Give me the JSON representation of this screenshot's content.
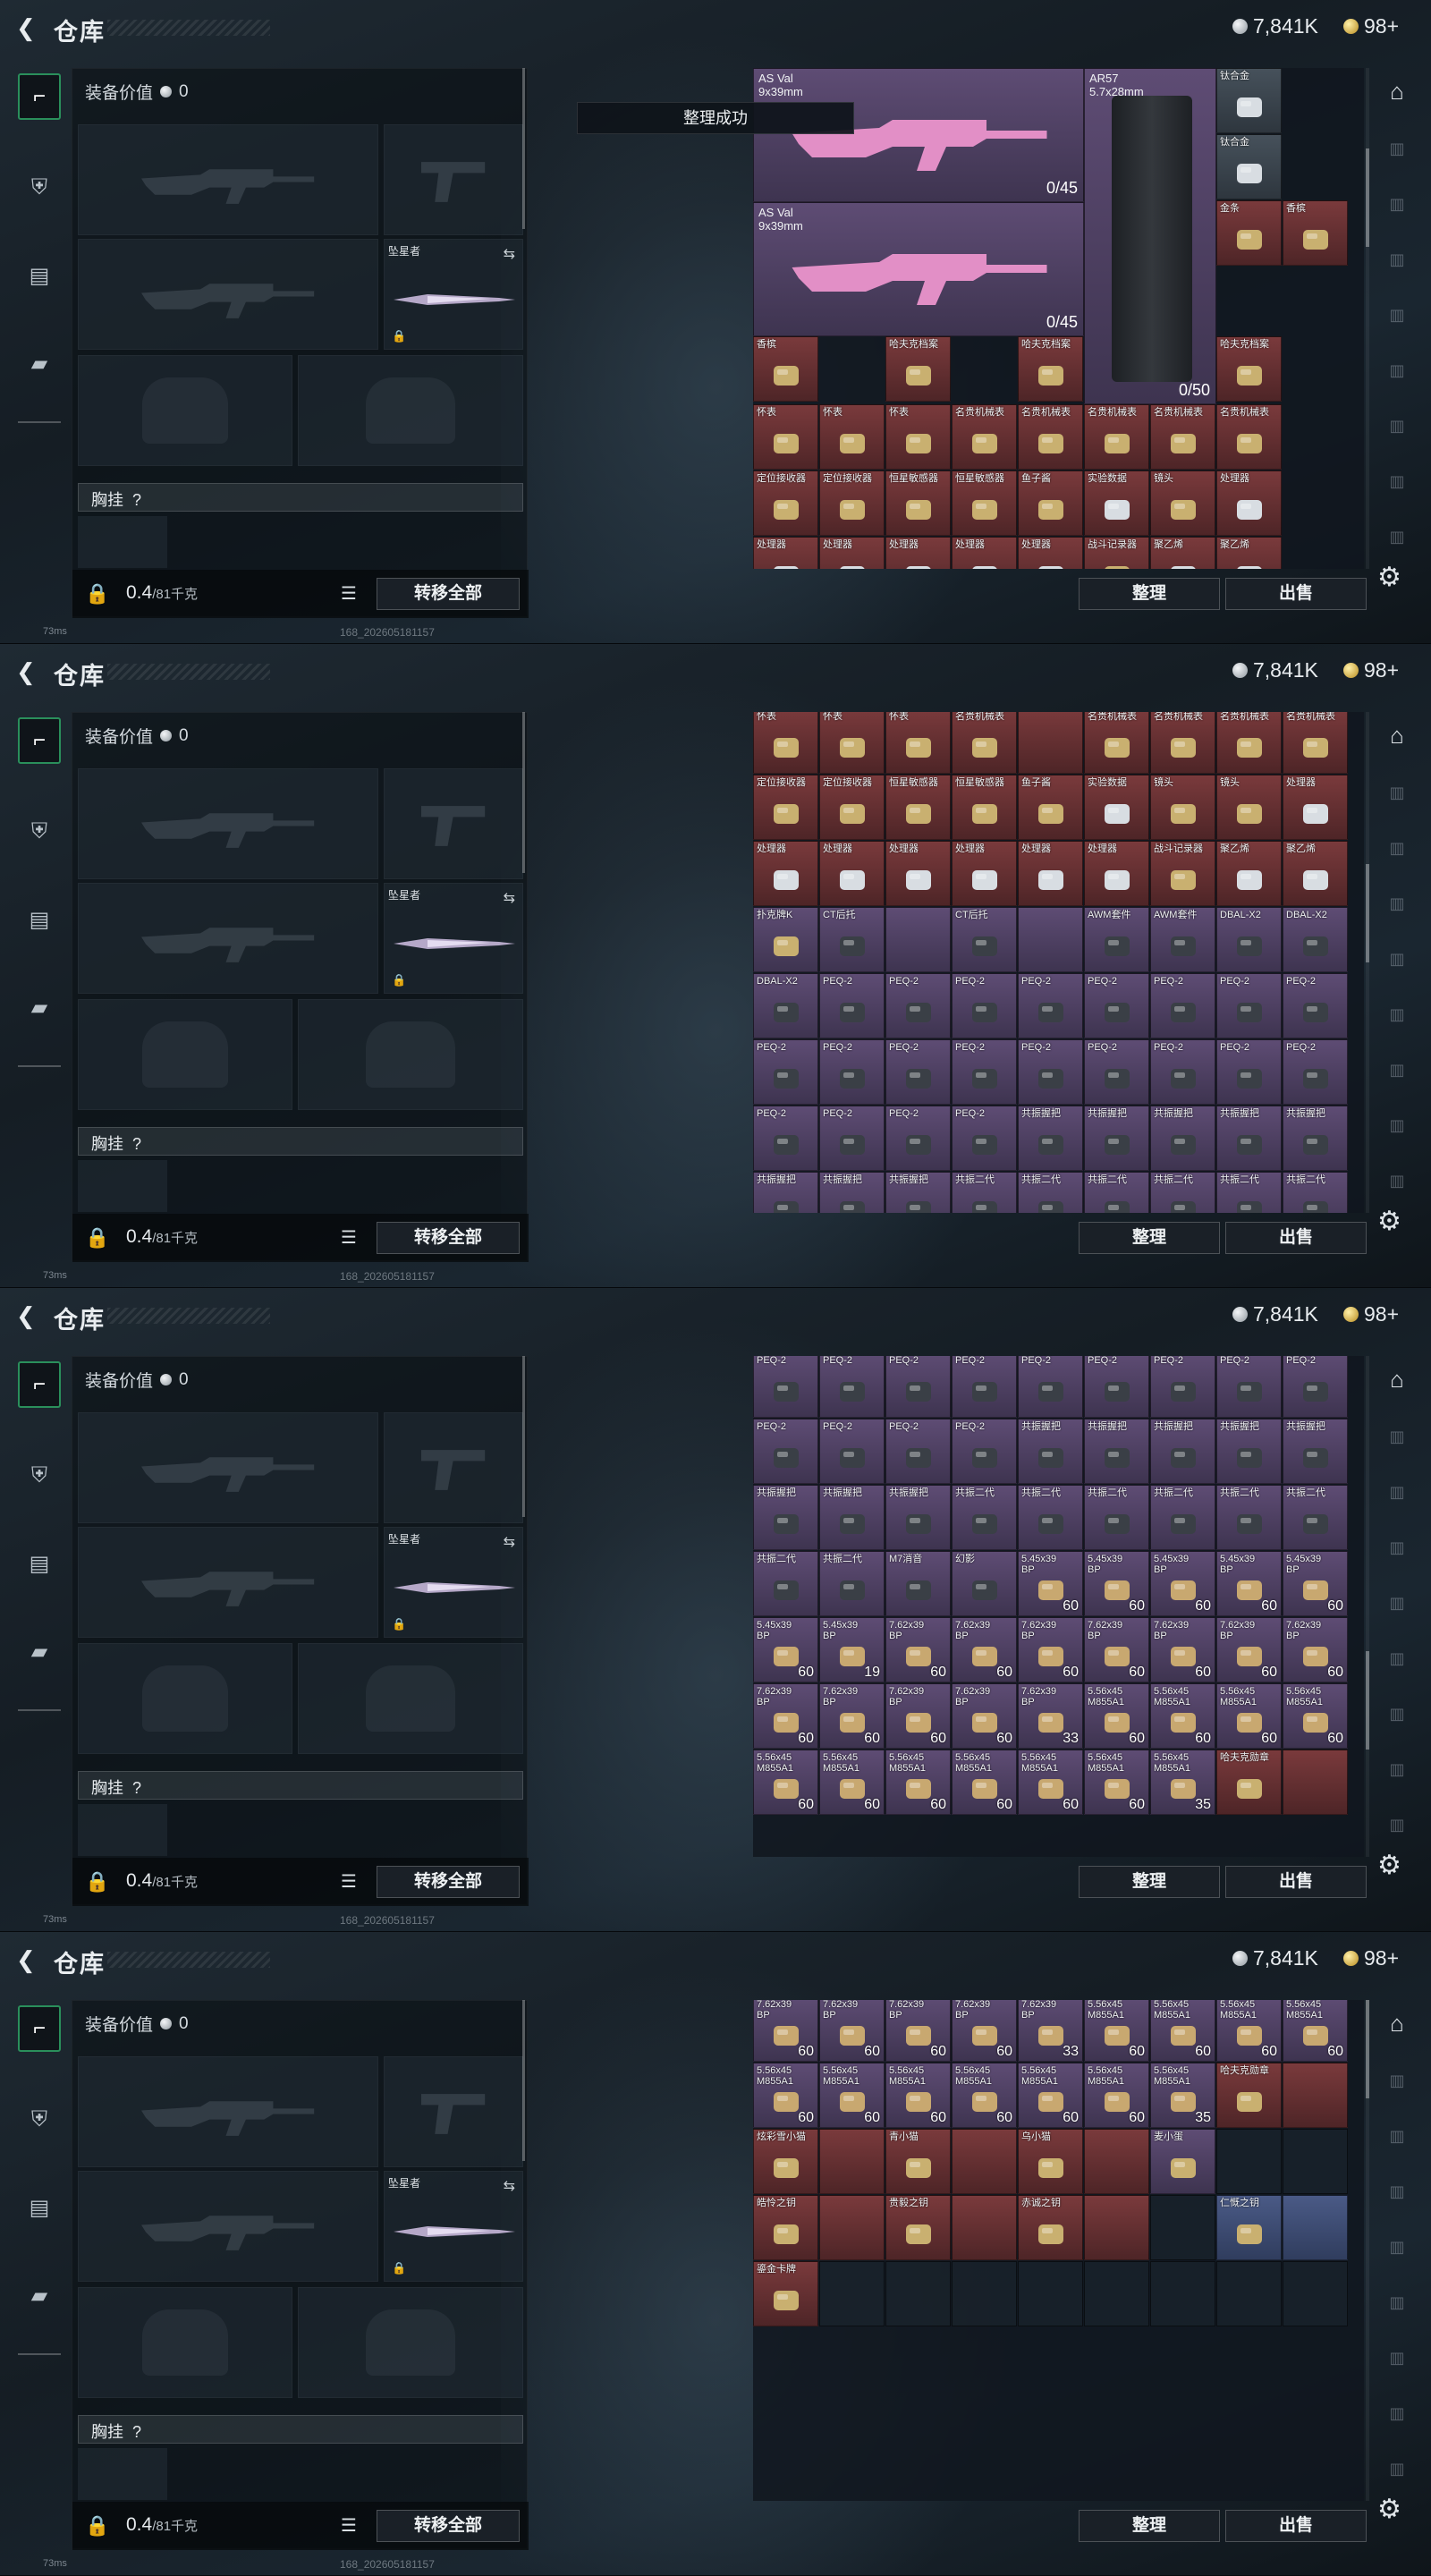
{
  "header": {
    "title": "仓库",
    "silver": "7,841K",
    "gold": "98+"
  },
  "loadout": {
    "value_label": "装备价值",
    "value": "0",
    "melee_name": "坠星者",
    "chest_label": "胸挂",
    "chest_hint": "?",
    "weight_current": "0.4",
    "weight_max": "/81千克",
    "transfer_all": "转移全部"
  },
  "footer": {
    "sort": "整理",
    "sell": "出售",
    "ping": "73ms",
    "build": "168_202605181157"
  },
  "toast": "整理成功",
  "frame1": {
    "weapons": [
      {
        "name": "AS Val\n9x39mm",
        "ammo": "0/45"
      },
      {
        "name": "AS Val\n9x39mm",
        "ammo": "0/45"
      },
      {
        "name": "AR57\n5.7x28mm",
        "ammo": "0/50"
      }
    ],
    "cells": [
      {
        "n": "钛合金",
        "r": "gray"
      },
      {
        "n": "钛合金",
        "r": "gray"
      },
      {
        "n": "金条",
        "r": "red"
      },
      {
        "n": "香槟",
        "r": "red"
      },
      {
        "n": "香槟",
        "r": "red"
      },
      {
        "n": "哈夫克档案",
        "r": "red"
      },
      {
        "n": "哈夫克档案",
        "r": "red"
      },
      {
        "n": "哈夫克档案",
        "r": "red"
      },
      {
        "n": "怀表",
        "r": "red"
      },
      {
        "n": "怀表",
        "r": "red"
      },
      {
        "n": "怀表",
        "r": "red"
      },
      {
        "n": "名贵机械表",
        "r": "red"
      },
      {
        "n": "名贵机械表",
        "r": "red"
      },
      {
        "n": "名贵机械表",
        "r": "red"
      },
      {
        "n": "名贵机械表",
        "r": "red"
      },
      {
        "n": "名贵机械表",
        "r": "red"
      },
      {
        "n": "定位接收器",
        "r": "red"
      },
      {
        "n": "定位接收器",
        "r": "red"
      },
      {
        "n": "恒星敏感器",
        "r": "red"
      },
      {
        "n": "恒星敏感器",
        "r": "red"
      },
      {
        "n": "鱼子酱",
        "r": "red"
      },
      {
        "n": "实验数据",
        "r": "red"
      },
      {
        "n": "镜头",
        "r": "red"
      },
      {
        "n": "处理器",
        "r": "red"
      },
      {
        "n": "处理器",
        "r": "red"
      },
      {
        "n": "处理器",
        "r": "red"
      },
      {
        "n": "处理器",
        "r": "red"
      },
      {
        "n": "处理器",
        "r": "red"
      },
      {
        "n": "处理器",
        "r": "red"
      },
      {
        "n": "战斗记录器",
        "r": "red"
      },
      {
        "n": "聚乙烯",
        "r": "red"
      },
      {
        "n": "聚乙烯",
        "r": "red"
      }
    ]
  },
  "frame2": {
    "rows": [
      [
        {
          "n": "怀表",
          "r": "red"
        },
        {
          "n": "怀表",
          "r": "red"
        },
        {
          "n": "怀表",
          "r": "red"
        },
        {
          "n": "名贵机械表",
          "r": "red"
        },
        {
          "n": "",
          "r": "red"
        },
        {
          "n": "名贵机械表",
          "r": "red"
        },
        {
          "n": "名贵机械表",
          "r": "red"
        },
        {
          "n": "名贵机械表",
          "r": "red"
        },
        {
          "n": "名贵机械表",
          "r": "red"
        }
      ],
      [
        {
          "n": "定位接收器",
          "r": "red"
        },
        {
          "n": "定位接收器",
          "r": "red"
        },
        {
          "n": "恒星敏感器",
          "r": "red"
        },
        {
          "n": "恒星敏感器",
          "r": "red"
        },
        {
          "n": "鱼子酱",
          "r": "red"
        },
        {
          "n": "实验数据",
          "r": "red"
        },
        {
          "n": "镜头",
          "r": "red"
        },
        {
          "n": "镜头",
          "r": "red"
        },
        {
          "n": "处理器",
          "r": "red"
        }
      ],
      [
        {
          "n": "处理器",
          "r": "red"
        },
        {
          "n": "处理器",
          "r": "red"
        },
        {
          "n": "处理器",
          "r": "red"
        },
        {
          "n": "处理器",
          "r": "red"
        },
        {
          "n": "处理器",
          "r": "red"
        },
        {
          "n": "处理器",
          "r": "red"
        },
        {
          "n": "战斗记录器",
          "r": "red"
        },
        {
          "n": "聚乙烯",
          "r": "red"
        },
        {
          "n": "聚乙烯",
          "r": "red"
        }
      ],
      [
        {
          "n": "扑克牌K",
          "r": "purple"
        },
        {
          "n": "CT后托",
          "r": "purple"
        },
        {
          "n": "",
          "r": "purple"
        },
        {
          "n": "CT后托",
          "r": "purple"
        },
        {
          "n": "",
          "r": "purple"
        },
        {
          "n": "AWM套件",
          "r": "purple"
        },
        {
          "n": "AWM套件",
          "r": "purple"
        },
        {
          "n": "DBAL-X2",
          "r": "purple"
        },
        {
          "n": "DBAL-X2",
          "r": "purple"
        }
      ],
      [
        {
          "n": "DBAL-X2",
          "r": "purple"
        },
        {
          "n": "PEQ-2",
          "r": "purple"
        },
        {
          "n": "PEQ-2",
          "r": "purple"
        },
        {
          "n": "PEQ-2",
          "r": "purple"
        },
        {
          "n": "PEQ-2",
          "r": "purple"
        },
        {
          "n": "PEQ-2",
          "r": "purple"
        },
        {
          "n": "PEQ-2",
          "r": "purple"
        },
        {
          "n": "PEQ-2",
          "r": "purple"
        },
        {
          "n": "PEQ-2",
          "r": "purple"
        }
      ],
      [
        {
          "n": "PEQ-2",
          "r": "purple"
        },
        {
          "n": "PEQ-2",
          "r": "purple"
        },
        {
          "n": "PEQ-2",
          "r": "purple"
        },
        {
          "n": "PEQ-2",
          "r": "purple"
        },
        {
          "n": "PEQ-2",
          "r": "purple"
        },
        {
          "n": "PEQ-2",
          "r": "purple"
        },
        {
          "n": "PEQ-2",
          "r": "purple"
        },
        {
          "n": "PEQ-2",
          "r": "purple"
        },
        {
          "n": "PEQ-2",
          "r": "purple"
        }
      ],
      [
        {
          "n": "PEQ-2",
          "r": "purple"
        },
        {
          "n": "PEQ-2",
          "r": "purple"
        },
        {
          "n": "PEQ-2",
          "r": "purple"
        },
        {
          "n": "PEQ-2",
          "r": "purple"
        },
        {
          "n": "共振握把",
          "r": "purple"
        },
        {
          "n": "共振握把",
          "r": "purple"
        },
        {
          "n": "共振握把",
          "r": "purple"
        },
        {
          "n": "共振握把",
          "r": "purple"
        },
        {
          "n": "共振握把",
          "r": "purple"
        }
      ],
      [
        {
          "n": "共振握把",
          "r": "purple"
        },
        {
          "n": "共振握把",
          "r": "purple"
        },
        {
          "n": "共振握把",
          "r": "purple"
        },
        {
          "n": "共振二代",
          "r": "purple"
        },
        {
          "n": "共振二代",
          "r": "purple"
        },
        {
          "n": "共振二代",
          "r": "purple"
        },
        {
          "n": "共振二代",
          "r": "purple"
        },
        {
          "n": "共振二代",
          "r": "purple"
        },
        {
          "n": "共振二代",
          "r": "purple"
        }
      ]
    ]
  },
  "frame3": {
    "rows": [
      [
        {
          "n": "PEQ-2",
          "r": "purple"
        },
        {
          "n": "PEQ-2",
          "r": "purple"
        },
        {
          "n": "PEQ-2",
          "r": "purple"
        },
        {
          "n": "PEQ-2",
          "r": "purple"
        },
        {
          "n": "PEQ-2",
          "r": "purple"
        },
        {
          "n": "PEQ-2",
          "r": "purple"
        },
        {
          "n": "PEQ-2",
          "r": "purple"
        },
        {
          "n": "PEQ-2",
          "r": "purple"
        },
        {
          "n": "PEQ-2",
          "r": "purple"
        }
      ],
      [
        {
          "n": "PEQ-2",
          "r": "purple"
        },
        {
          "n": "PEQ-2",
          "r": "purple"
        },
        {
          "n": "PEQ-2",
          "r": "purple"
        },
        {
          "n": "PEQ-2",
          "r": "purple"
        },
        {
          "n": "共振握把",
          "r": "purple"
        },
        {
          "n": "共振握把",
          "r": "purple"
        },
        {
          "n": "共振握把",
          "r": "purple"
        },
        {
          "n": "共振握把",
          "r": "purple"
        },
        {
          "n": "共振握把",
          "r": "purple"
        }
      ],
      [
        {
          "n": "共振握把",
          "r": "purple"
        },
        {
          "n": "共振握把",
          "r": "purple"
        },
        {
          "n": "共振握把",
          "r": "purple"
        },
        {
          "n": "共振二代",
          "r": "purple"
        },
        {
          "n": "共振二代",
          "r": "purple"
        },
        {
          "n": "共振二代",
          "r": "purple"
        },
        {
          "n": "共振二代",
          "r": "purple"
        },
        {
          "n": "共振二代",
          "r": "purple"
        },
        {
          "n": "共振二代",
          "r": "purple"
        }
      ],
      [
        {
          "n": "共振二代",
          "r": "purple"
        },
        {
          "n": "共振二代",
          "r": "purple"
        },
        {
          "n": "M7消音",
          "r": "purple"
        },
        {
          "n": "幻影",
          "r": "purple"
        },
        {
          "n": "5.45x39\nBP",
          "r": "purple",
          "q": "60"
        },
        {
          "n": "5.45x39\nBP",
          "r": "purple",
          "q": "60"
        },
        {
          "n": "5.45x39\nBP",
          "r": "purple",
          "q": "60"
        },
        {
          "n": "5.45x39\nBP",
          "r": "purple",
          "q": "60"
        },
        {
          "n": "5.45x39\nBP",
          "r": "purple",
          "q": "60"
        }
      ],
      [
        {
          "n": "5.45x39\nBP",
          "r": "purple",
          "q": "60"
        },
        {
          "n": "5.45x39\nBP",
          "r": "purple",
          "q": "19"
        },
        {
          "n": "7.62x39\nBP",
          "r": "purple",
          "q": "60"
        },
        {
          "n": "7.62x39\nBP",
          "r": "purple",
          "q": "60"
        },
        {
          "n": "7.62x39\nBP",
          "r": "purple",
          "q": "60"
        },
        {
          "n": "7.62x39\nBP",
          "r": "purple",
          "q": "60"
        },
        {
          "n": "7.62x39\nBP",
          "r": "purple",
          "q": "60"
        },
        {
          "n": "7.62x39\nBP",
          "r": "purple",
          "q": "60"
        },
        {
          "n": "7.62x39\nBP",
          "r": "purple",
          "q": "60"
        }
      ],
      [
        {
          "n": "7.62x39\nBP",
          "r": "purple",
          "q": "60"
        },
        {
          "n": "7.62x39\nBP",
          "r": "purple",
          "q": "60"
        },
        {
          "n": "7.62x39\nBP",
          "r": "purple",
          "q": "60"
        },
        {
          "n": "7.62x39\nBP",
          "r": "purple",
          "q": "60"
        },
        {
          "n": "7.62x39\nBP",
          "r": "purple",
          "q": "33"
        },
        {
          "n": "5.56x45\nM855A1",
          "r": "purple",
          "q": "60"
        },
        {
          "n": "5.56x45\nM855A1",
          "r": "purple",
          "q": "60"
        },
        {
          "n": "5.56x45\nM855A1",
          "r": "purple",
          "q": "60"
        },
        {
          "n": "5.56x45\nM855A1",
          "r": "purple",
          "q": "60"
        }
      ],
      [
        {
          "n": "5.56x45\nM855A1",
          "r": "purple",
          "q": "60"
        },
        {
          "n": "5.56x45\nM855A1",
          "r": "purple",
          "q": "60"
        },
        {
          "n": "5.56x45\nM855A1",
          "r": "purple",
          "q": "60"
        },
        {
          "n": "5.56x45\nM855A1",
          "r": "purple",
          "q": "60"
        },
        {
          "n": "5.56x45\nM855A1",
          "r": "purple",
          "q": "60"
        },
        {
          "n": "5.56x45\nM855A1",
          "r": "purple",
          "q": "60"
        },
        {
          "n": "5.56x45\nM855A1",
          "r": "purple",
          "q": "35"
        },
        {
          "n": "哈夫克勋章",
          "r": "red"
        },
        {
          "n": "",
          "r": "red"
        }
      ]
    ]
  },
  "frame4": {
    "rows": [
      [
        {
          "n": "7.62x39\nBP",
          "r": "purple",
          "q": "60"
        },
        {
          "n": "7.62x39\nBP",
          "r": "purple",
          "q": "60"
        },
        {
          "n": "7.62x39\nBP",
          "r": "purple",
          "q": "60"
        },
        {
          "n": "7.62x39\nBP",
          "r": "purple",
          "q": "60"
        },
        {
          "n": "7.62x39\nBP",
          "r": "purple",
          "q": "33"
        },
        {
          "n": "5.56x45\nM855A1",
          "r": "purple",
          "q": "60"
        },
        {
          "n": "5.56x45\nM855A1",
          "r": "purple",
          "q": "60"
        },
        {
          "n": "5.56x45\nM855A1",
          "r": "purple",
          "q": "60"
        },
        {
          "n": "5.56x45\nM855A1",
          "r": "purple",
          "q": "60"
        }
      ],
      [
        {
          "n": "5.56x45\nM855A1",
          "r": "purple",
          "q": "60"
        },
        {
          "n": "5.56x45\nM855A1",
          "r": "purple",
          "q": "60"
        },
        {
          "n": "5.56x45\nM855A1",
          "r": "purple",
          "q": "60"
        },
        {
          "n": "5.56x45\nM855A1",
          "r": "purple",
          "q": "60"
        },
        {
          "n": "5.56x45\nM855A1",
          "r": "purple",
          "q": "60"
        },
        {
          "n": "5.56x45\nM855A1",
          "r": "purple",
          "q": "60"
        },
        {
          "n": "5.56x45\nM855A1",
          "r": "purple",
          "q": "35"
        },
        {
          "n": "哈夫克勋章",
          "r": "red"
        },
        {
          "n": "",
          "r": "red"
        }
      ],
      [
        {
          "n": "炫彩雪小猫",
          "r": "red"
        },
        {
          "n": "",
          "r": "red"
        },
        {
          "n": "青小猫",
          "r": "red"
        },
        {
          "n": "",
          "r": "red"
        },
        {
          "n": "乌小猫",
          "r": "red"
        },
        {
          "n": "",
          "r": "red"
        },
        {
          "n": "麦小蛋",
          "r": "purple"
        },
        {
          "n": "",
          "r": "empty"
        },
        {
          "n": "",
          "r": "empty"
        }
      ],
      [
        {
          "n": "皓怜之钥",
          "r": "red"
        },
        {
          "n": "",
          "r": "red"
        },
        {
          "n": "贵毅之钥",
          "r": "red"
        },
        {
          "n": "",
          "r": "red"
        },
        {
          "n": "赤诚之钥",
          "r": "red"
        },
        {
          "n": "",
          "r": "red"
        },
        {
          "n": "",
          "r": "empty"
        },
        {
          "n": "仁慨之钥",
          "r": "blue"
        },
        {
          "n": "",
          "r": "blue"
        }
      ],
      [
        {
          "n": "鎏金卡牌",
          "r": "red"
        },
        {
          "n": "",
          "r": "empty"
        },
        {
          "n": "",
          "r": "empty"
        },
        {
          "n": "",
          "r": "empty"
        },
        {
          "n": "",
          "r": "empty"
        },
        {
          "n": "",
          "r": "empty"
        },
        {
          "n": "",
          "r": "empty"
        },
        {
          "n": "",
          "r": "empty"
        },
        {
          "n": "",
          "r": "empty"
        }
      ]
    ]
  },
  "icons": {
    "back": "back-arrow-icon",
    "silver": "silver-coin-icon",
    "gold": "gold-coin-icon"
  }
}
